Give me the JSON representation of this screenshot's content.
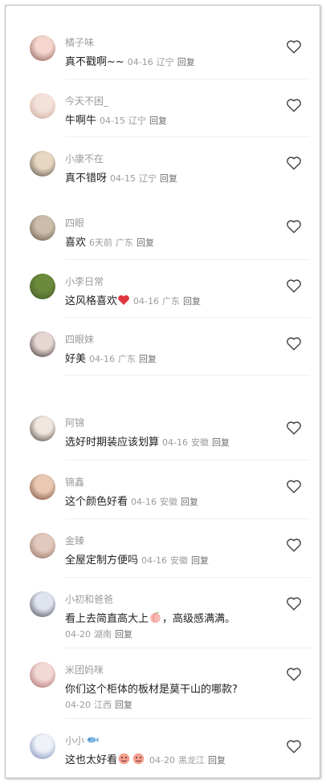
{
  "comments": [
    {
      "user": "橘子味",
      "text": "真不戳啊~~",
      "date": "04-16",
      "region": "辽宁",
      "reply": "回复",
      "avatar": [
        "#f4d6cf",
        "#7b4a3c"
      ]
    },
    {
      "user": "今天不困_",
      "text": "牛啊牛",
      "date": "04-15",
      "region": "辽宁",
      "reply": "回复",
      "avatar": [
        "#f3e2da",
        "#c7a08e"
      ]
    },
    {
      "user": "小康不在",
      "text": "真不错呀",
      "date": "04-15",
      "region": "辽宁",
      "reply": "回复",
      "avatar": [
        "#e7d7c3",
        "#4a4036"
      ]
    },
    {
      "user": "四眼",
      "text": "喜欢",
      "date": "6天前",
      "region": "广东",
      "reply": "回复",
      "avatar": [
        "#cbbda9",
        "#5b4c3f"
      ]
    },
    {
      "user": "小李日常",
      "text": "这风格喜欢",
      "date": "04-16",
      "region": "广东",
      "reply": "回复",
      "avatar": [
        "#6b8a3c",
        "#3e5223"
      ],
      "emoji": "heart"
    },
    {
      "user": "四眼妹",
      "text": "好美",
      "date": "04-16",
      "region": "广东",
      "reply": "回复",
      "avatar": [
        "#e6d7d3",
        "#2b2323"
      ]
    },
    {
      "user": "阿锦",
      "text": "选好时期装应该划算",
      "date": "04-16",
      "region": "安徽",
      "reply": "回复",
      "avatar": [
        "#efe6df",
        "#3b302b"
      ]
    },
    {
      "user": "锦鑫",
      "text": "这个颜色好看",
      "date": "04-16",
      "region": "安徽",
      "reply": "回复",
      "avatar": [
        "#e9c9b4",
        "#6a3c2a"
      ]
    },
    {
      "user": "金臻",
      "text": "全屋定制方便吗",
      "date": "04-16",
      "region": "安徽",
      "reply": "回复",
      "avatar": [
        "#e2c9bd",
        "#8a6557"
      ]
    },
    {
      "user": "小初和爸爸",
      "text": "看上去简直高大上",
      "text2": "，高级感满满。",
      "date": "04-20",
      "region": "湖南",
      "reply": "回复",
      "avatar": [
        "#dfe4ee",
        "#3a3a44"
      ],
      "emoji": "peach"
    },
    {
      "user": "米团妈咪",
      "text": "你们这个柜体的板材是莫干山的哪款?",
      "date": "04-20",
      "region": "江西",
      "reply": "回复",
      "avatar": [
        "#f3d9d6",
        "#a25d58"
      ]
    },
    {
      "user": "小小",
      "text": "这也太好看",
      "date": "04-20",
      "region": "黑龙江",
      "reply": "回复",
      "avatar": [
        "#eef1f7",
        "#6b7fb3"
      ],
      "user_emoji": "fish",
      "emoji": "face"
    }
  ]
}
